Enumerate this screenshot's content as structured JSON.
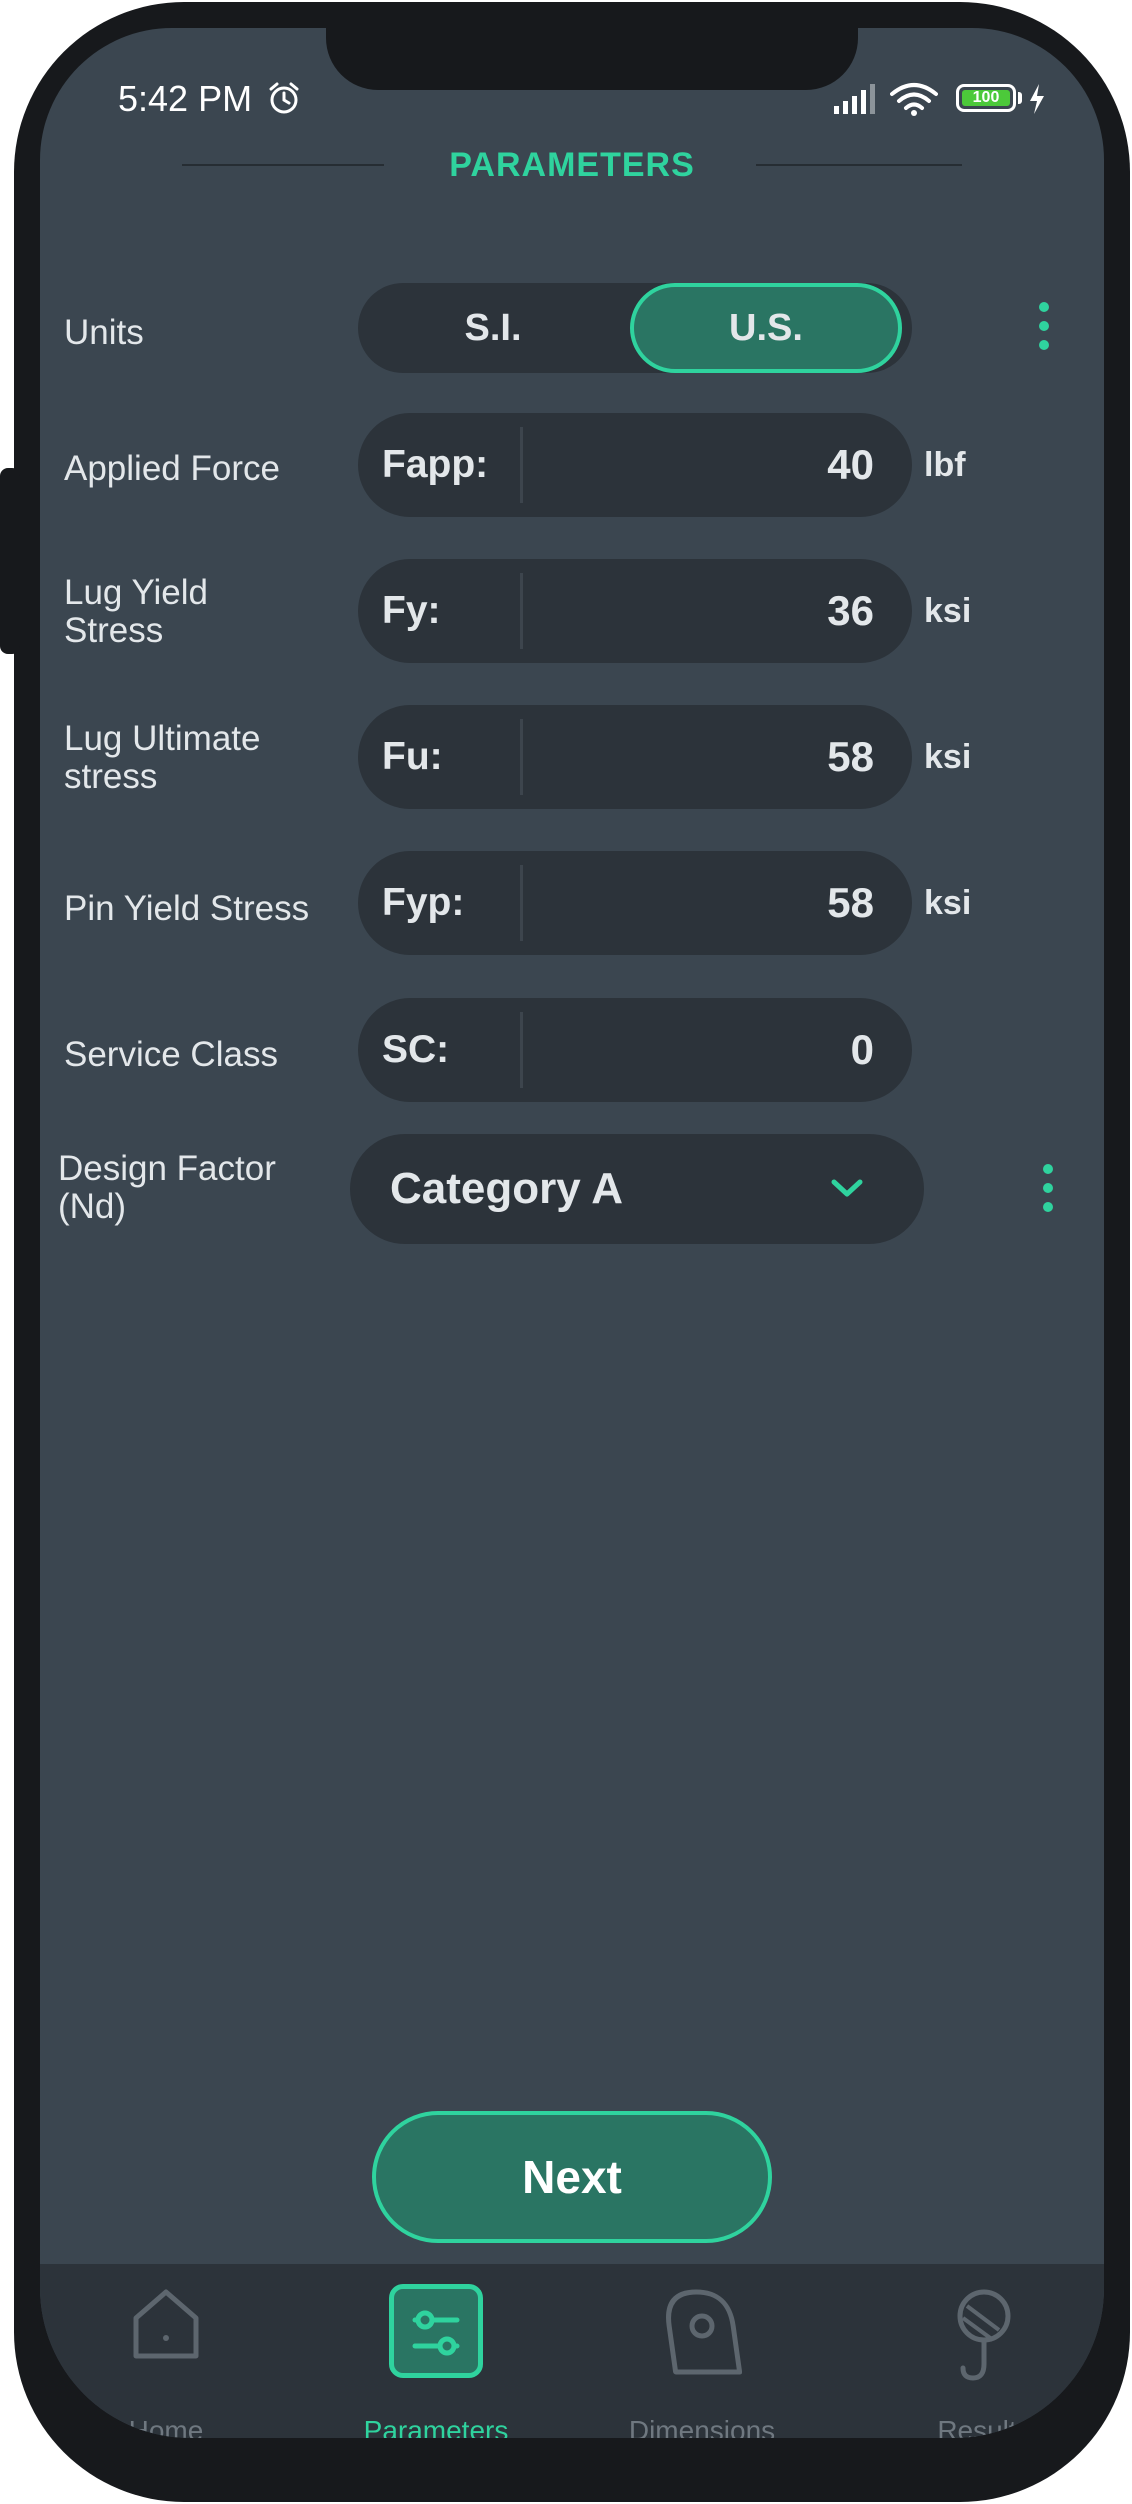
{
  "status_bar": {
    "time": "5:42 PM",
    "battery_level": "100",
    "icons": [
      "alarm-icon",
      "signal-icon",
      "wifi-icon",
      "battery-icon",
      "charging-bolt-icon"
    ]
  },
  "header": {
    "title": "PARAMETERS"
  },
  "units": {
    "label": "Units",
    "options": [
      "S.I.",
      "U.S."
    ],
    "selected": "U.S."
  },
  "fields": [
    {
      "label": "Applied Force",
      "prefix": "Fapp:",
      "value": "40",
      "unit": "lbf"
    },
    {
      "label_line1": "Lug Yield",
      "label_line2": "Stress",
      "prefix": "Fy:",
      "value": "36",
      "unit": "ksi"
    },
    {
      "label_line1": "Lug Ultimate",
      "label_line2": "stress",
      "prefix": "Fu:",
      "value": "58",
      "unit": "ksi"
    },
    {
      "label": "Pin Yield Stress",
      "prefix": "Fyp:",
      "value": "58",
      "unit": "ksi"
    },
    {
      "label": "Service Class",
      "prefix": "SC:",
      "value": "0",
      "unit": ""
    }
  ],
  "design_factor": {
    "label_line1": "Design Factor",
    "label_line2": "(Nd)",
    "selected": "Category A"
  },
  "next_button": {
    "label": "Next"
  },
  "bottom_nav": {
    "items": [
      {
        "label": "Home",
        "icon": "home-icon"
      },
      {
        "label": "Parameters",
        "icon": "sliders-icon",
        "active": true
      },
      {
        "label": "Dimensions",
        "icon": "lug-icon"
      },
      {
        "label": "Results",
        "icon": "hook-icon"
      }
    ]
  },
  "colors": {
    "accent": "#2fd39e",
    "accent_fill": "#2a7563",
    "background": "#3b4650",
    "field_bg": "#2c333a"
  }
}
